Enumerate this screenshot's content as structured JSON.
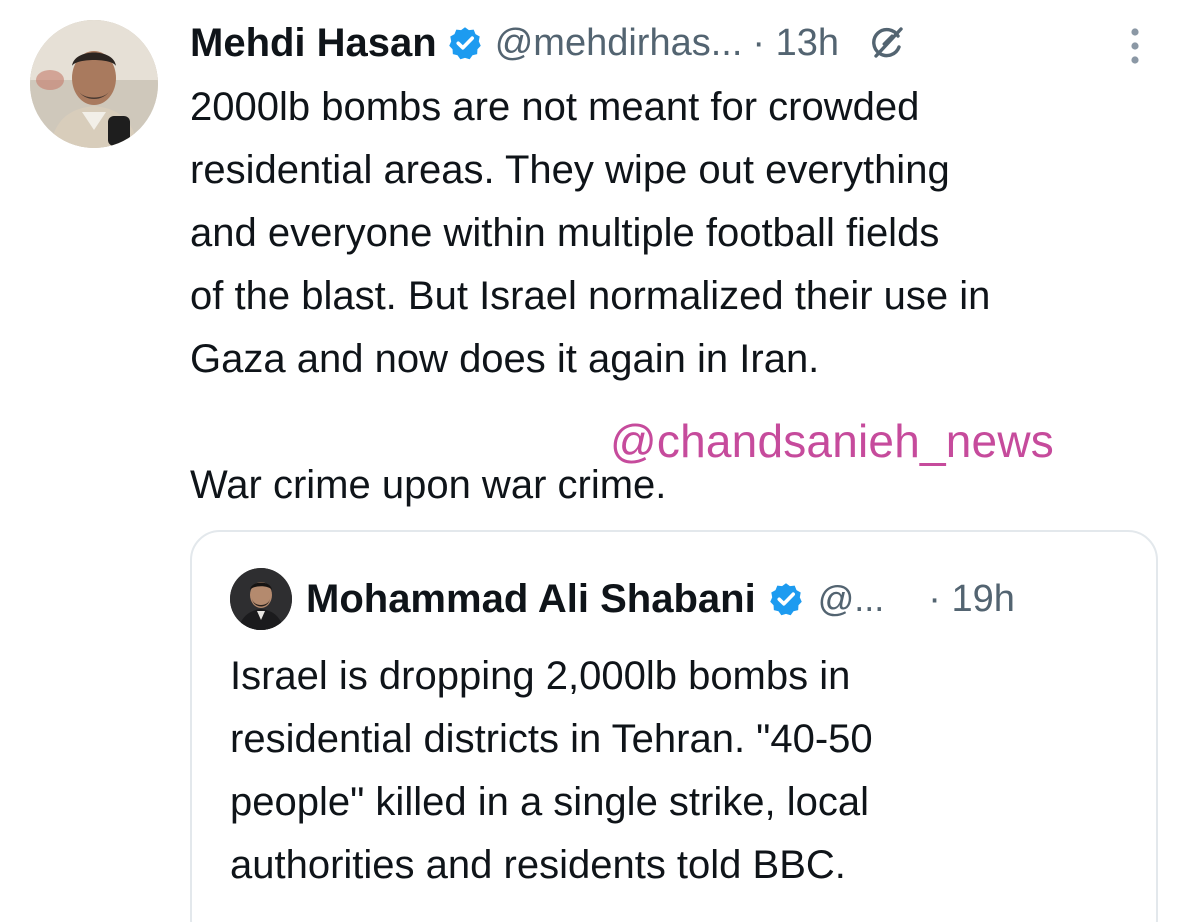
{
  "tweet": {
    "author_name": "Mehdi Hasan",
    "handle": "@mehdirhas...",
    "time": "· 13h",
    "verified": true,
    "body_lines": [
      "2000lb bombs are not meant for crowded",
      "residential areas. They wipe out everything",
      "and everyone within multiple football fields",
      "of the blast. But Israel normalized their use in",
      "Gaza and now does it again in Iran."
    ],
    "closing_line": "War crime upon war crime.",
    "icons": {
      "verified": "verified-badge-icon",
      "grok": "grok-icon",
      "more": "more-options-icon"
    }
  },
  "watermark": {
    "text": "@chandsanieh_news"
  },
  "quoted_tweet": {
    "author_name": "Mohammad Ali Shabani",
    "handle": "@...",
    "time": "· 19h",
    "verified": true,
    "body_lines": [
      "Israel is dropping 2,000lb bombs in",
      "residential districts in Tehran. \"40-50",
      "people\" killed in a single strike, local",
      "authorities and residents told BBC."
    ]
  },
  "colors": {
    "text_primary": "#0f1419",
    "text_secondary": "#536471",
    "verified_blue": "#1d9bf0",
    "watermark": "#c64b9c",
    "card_border": "#e3e8ec"
  }
}
